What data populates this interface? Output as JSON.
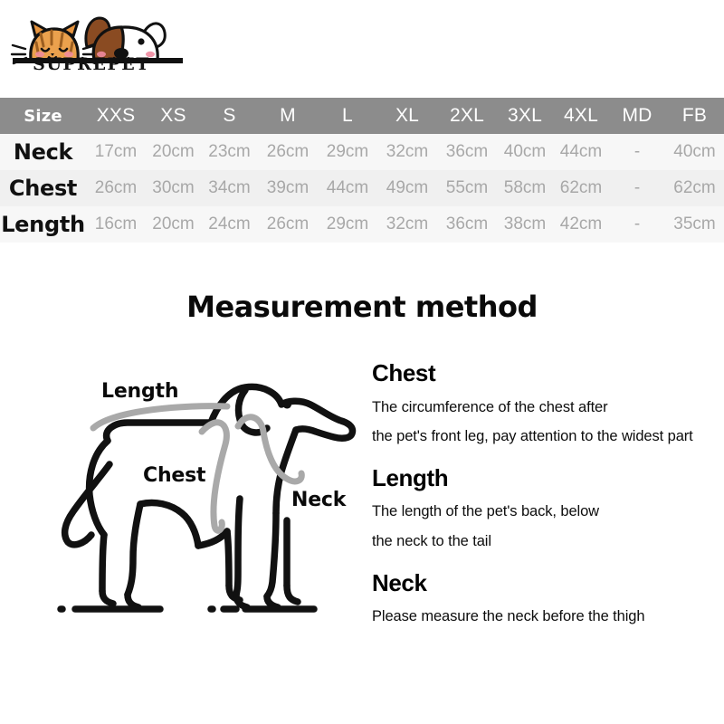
{
  "brand": {
    "name": "SUPREPET",
    "cat_icon": "cat-face-icon",
    "dog_icon": "dog-face-icon"
  },
  "size_table": {
    "headers": [
      "Size",
      "XXS",
      "XS",
      "S",
      "M",
      "L",
      "XL",
      "2XL",
      "3XL",
      "4XL",
      "MD",
      "FB"
    ],
    "rows": [
      {
        "label": "Neck",
        "values": [
          "17cm",
          "20cm",
          "23cm",
          "26cm",
          "29cm",
          "32cm",
          "36cm",
          "40cm",
          "44cm",
          "-",
          "40cm"
        ]
      },
      {
        "label": "Chest",
        "values": [
          "26cm",
          "30cm",
          "34cm",
          "39cm",
          "44cm",
          "49cm",
          "55cm",
          "58cm",
          "62cm",
          "-",
          "62cm"
        ]
      },
      {
        "label": "Length",
        "values": [
          "16cm",
          "20cm",
          "24cm",
          "26cm",
          "29cm",
          "32cm",
          "36cm",
          "38cm",
          "42cm",
          "-",
          "35cm"
        ]
      }
    ],
    "header_bg": "#8c8c8c",
    "header_text": "#ffffff",
    "value_text": "#a8a8a8",
    "row_bg_a": "#f7f7f7",
    "row_bg_b": "#f0f0f0"
  },
  "section": {
    "title": "Measurement method"
  },
  "diagram": {
    "labels": {
      "length": "Length",
      "chest": "Chest",
      "neck": "Neck"
    },
    "outline_color": "#111111",
    "measure_color": "#a9a9a9"
  },
  "info": {
    "chest": {
      "heading": "Chest",
      "line1": "The circumference of the chest after",
      "line2": "the pet's front leg, pay attention to the widest part"
    },
    "length": {
      "heading": "Length",
      "line1": "The length of the pet's back, below",
      "line2": "the neck to the tail"
    },
    "neck": {
      "heading": "Neck",
      "line1": "Please measure the neck before the thigh"
    }
  }
}
